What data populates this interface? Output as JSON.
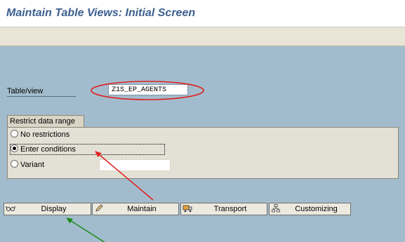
{
  "window": {
    "title": "Maintain Table Views: Initial Screen"
  },
  "table_view": {
    "label": "Table/view",
    "value": "Z1S_EP_AGENTS"
  },
  "restrict": {
    "group_title": "Restrict data range",
    "options": [
      {
        "label": "No restrictions",
        "selected": false
      },
      {
        "label": "Enter conditions",
        "selected": true
      },
      {
        "label": "Variant",
        "selected": false
      }
    ],
    "variant_value": ""
  },
  "buttons": {
    "display": {
      "label": "Display",
      "icon": "glasses-icon"
    },
    "maintain": {
      "label": "Maintain",
      "icon": "pencil-icon"
    },
    "transport": {
      "label": "Transport",
      "icon": "truck-icon"
    },
    "customizing": {
      "label": "Customizing",
      "icon": "hierarchy-icon"
    }
  },
  "colors": {
    "background": "#a3bccd",
    "title": "#3c5f8e",
    "annotation_red": "#e02020",
    "annotation_green": "#1a8a1a"
  }
}
